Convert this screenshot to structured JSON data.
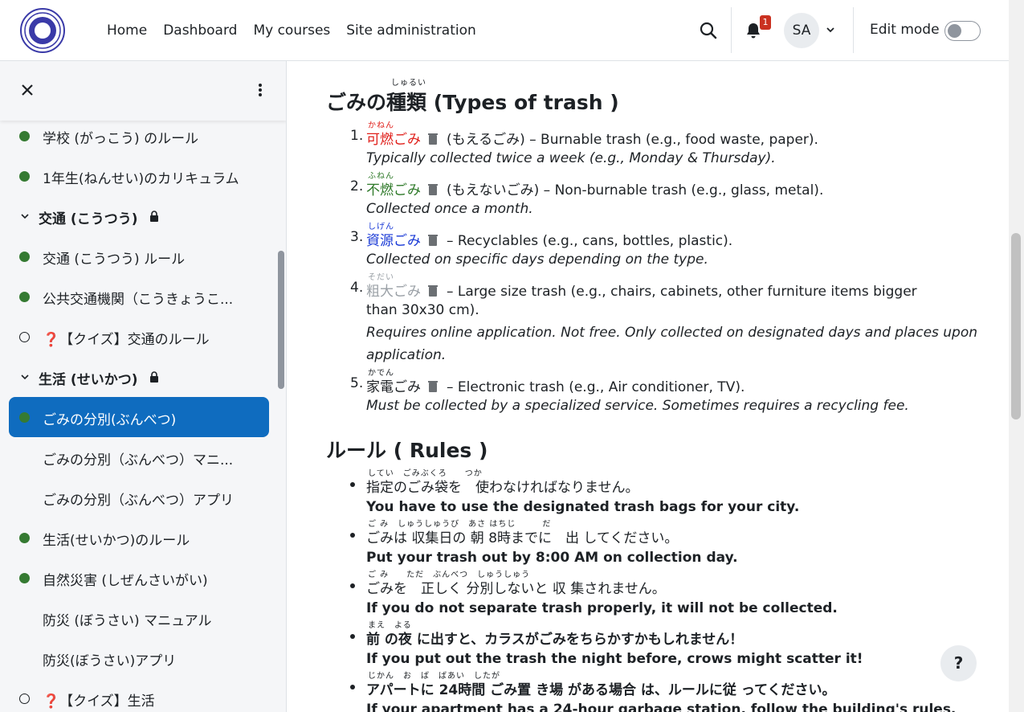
{
  "nav": {
    "items": [
      "Home",
      "Dashboard",
      "My courses",
      "Site administration"
    ]
  },
  "header": {
    "notification_count": "1",
    "avatar_initials": "SA",
    "edit_mode_label": "Edit mode"
  },
  "sidebar": {
    "items": [
      {
        "label": "学校 (がっこう) のルール",
        "kind": "done"
      },
      {
        "label": "1年生(ねんせい)のカリキュラム",
        "kind": "done"
      },
      {
        "label": "交通 (こうつう)",
        "kind": "section"
      },
      {
        "label": "交通 (こうつう) ルール",
        "kind": "done"
      },
      {
        "label": "公共交通機関（こうきょうこ...",
        "kind": "done"
      },
      {
        "label": "❓【クイズ】交通のルール",
        "kind": "todo"
      },
      {
        "label": "生活 (せいかつ)",
        "kind": "section"
      },
      {
        "label": "ごみの分別(ぶんべつ)",
        "kind": "active"
      },
      {
        "label": "ごみの分別（ぶんべつ）マニ...",
        "kind": "none"
      },
      {
        "label": "ごみの分別（ぶんべつ）アプリ",
        "kind": "none"
      },
      {
        "label": "生活(せいかつ)のルール",
        "kind": "done"
      },
      {
        "label": "自然災害 (しぜんさいがい)",
        "kind": "done"
      },
      {
        "label": "防災 (ぼうさい) マニュアル",
        "kind": "none"
      },
      {
        "label": "防災(ぼうさい)アプリ",
        "kind": "none"
      },
      {
        "label": "❓【クイズ】生活",
        "kind": "todo"
      }
    ]
  },
  "content": {
    "types_heading": "ごみの種類 (Types of trash )",
    "types_heading_ruby": "しゅるい",
    "types": [
      {
        "num": "1.",
        "jp": "可燃ごみ",
        "ruby": "かねん",
        "reading": "(もえるごみ) – Burnable trash (e.g., food waste, paper).",
        "note": "Typically collected twice a week (e.g., Monday & Thursday).",
        "color": "#e0201b"
      },
      {
        "num": "2.",
        "jp": "不燃ごみ",
        "ruby": "ふねん",
        "reading": "(もえないごみ) – Non-burnable trash (e.g., glass, metal).",
        "note": "Collected once a month.",
        "color": "#2f7a2a"
      },
      {
        "num": "3.",
        "jp": "資源ごみ",
        "ruby": "しげん",
        "reading": "– Recyclables (e.g., cans, bottles, plastic).",
        "note": "Collected on specific days depending on the type.",
        "color": "#1a3ad6"
      },
      {
        "num": "4.",
        "jp": "粗大ごみ",
        "ruby": "そだい",
        "reading": "– Large size trash (e.g., chairs, cabinets, other furniture items bigger",
        "reading2": "than 30x30 cm).",
        "note": "Requires online application. Not free. Only collected on designated days and places upon",
        "note2": "application.",
        "color": "#9aa0a6"
      },
      {
        "num": "5.",
        "jp": "家電ごみ",
        "ruby": "かでん",
        "reading": "– Electronic trash (e.g., Air conditioner, TV).",
        "note": "Must be collected by a specialized service. Sometimes requires a recycling fee.",
        "color": "#1d2125"
      }
    ],
    "rules_heading": "ルール ( Rules )",
    "rules": [
      {
        "jp": "指定のごみ袋を　使わなければなりません。",
        "ruby": "してい　ごみぶくろ　　つか",
        "en": "You have to use the designated trash bags for your city."
      },
      {
        "jp": "ごみは 収集日の 朝 8時までに　出 してください。",
        "ruby": "ご み　しゅうしゅうび　あさ はちじ　　　だ",
        "en": "Put your trash out by 8:00 AM on collection day."
      },
      {
        "jp": "ごみを　正しく 分別しないと 収 集されません。",
        "ruby": "ご み　　ただ　ぶんべつ　しゅうしゅう",
        "en": "If you do not separate trash properly, it will not be collected."
      },
      {
        "jp": "前 の夜 に出すと、カラスがごみをちらかすかもしれません！",
        "ruby": "まえ　よる",
        "en": "If you put out the trash the night before, crows might scatter it!"
      },
      {
        "jp": "アパートに 24時間 ごみ置 き場 がある場合 は、ルールに従 ってください。",
        "ruby": "じかん　お　ば　ばあい　したが",
        "en": "If your apartment has a 24-hour garbage station, follow the building's rules."
      }
    ]
  },
  "help_label": "?"
}
